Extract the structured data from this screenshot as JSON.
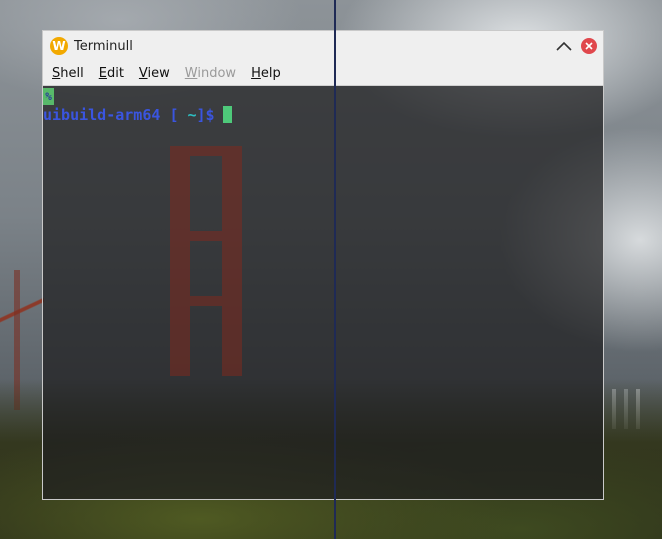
{
  "window": {
    "title": "Terminull",
    "app_icon_letter": "W"
  },
  "menus": [
    {
      "label": "Shell",
      "mnemonic": "S",
      "rest": "hell",
      "enabled": true
    },
    {
      "label": "Edit",
      "mnemonic": "E",
      "rest": "dit",
      "enabled": true
    },
    {
      "label": "View",
      "mnemonic": "V",
      "rest": "iew",
      "enabled": true
    },
    {
      "label": "Window",
      "mnemonic": "W",
      "rest": "indow",
      "enabled": false
    },
    {
      "label": "Help",
      "mnemonic": "H",
      "rest": "elp",
      "enabled": true
    }
  ],
  "terminal": {
    "badge": "%",
    "host": "uibuild-arm64",
    "open_bracket": "[",
    "path": "~",
    "close": "]$"
  },
  "colors": {
    "prompt": "#3a55e0",
    "cursor": "#4ec97a",
    "close_button": "#e0474c"
  }
}
